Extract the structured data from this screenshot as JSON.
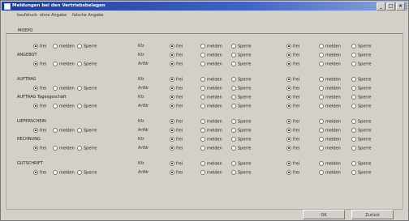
{
  "window": {
    "title": "Meldungen bei den Vertriebsbelegen",
    "controls": [
      "_",
      "□",
      "×"
    ]
  },
  "tabs": [
    "kaufdruck",
    "ohne Angabe",
    "falsche Angabe"
  ],
  "group_label": "MOEPO",
  "options": [
    "frei",
    "melden",
    "Sperre"
  ],
  "kfz_label": "Kfz",
  "artnr_label": "ArtNr",
  "sections": [
    {
      "name": "MOEPO",
      "subtitle": "ANGEBOT"
    },
    {
      "name": "AUFTRAG"
    },
    {
      "name": "AUFTRAG Tagesgeschäft"
    },
    {
      "name": "LIEFERSCHEIN"
    },
    {
      "name": "RECHNUNG"
    },
    {
      "name": "GUTSCHRIFT"
    }
  ],
  "rows": [
    {
      "label": "",
      "left_options": [
        "frei",
        "melden",
        "Sperre"
      ],
      "tag": "Kfz",
      "cols": [
        "frei",
        "melden",
        "Sperre",
        "frei",
        "melden",
        "Sperre"
      ],
      "checked": [
        true,
        false,
        false,
        true,
        false,
        false
      ]
    },
    {
      "label": "ANGEBOT",
      "left_options": [],
      "tag": "Kfz",
      "cols": [
        "frei",
        "melden",
        "Sperre",
        "frei",
        "melden",
        "Sperre"
      ],
      "checked": [
        true,
        false,
        false,
        true,
        false,
        false
      ]
    },
    {
      "label": "",
      "left_options": [
        "frei",
        "melden",
        "Sperre"
      ],
      "tag": "ArtNr",
      "cols": [
        "frei",
        "melden",
        "Sperre",
        "frei",
        "melden",
        "Sperre"
      ],
      "checked": [
        true,
        false,
        false,
        true,
        false,
        false
      ]
    },
    {
      "label": "AUFTRAG",
      "left_options": [],
      "tag": "Kfz",
      "cols": [
        "frei",
        "melden",
        "Sperre",
        "frei",
        "melden",
        "Sperre"
      ],
      "checked": [
        true,
        false,
        false,
        true,
        false,
        false
      ]
    },
    {
      "label": "",
      "left_options": [
        "frei",
        "melden",
        "Sperre"
      ],
      "tag": "ArtNr",
      "cols": [
        "frei",
        "melden",
        "Sperre",
        "frei",
        "melden",
        "Sperre"
      ],
      "checked": [
        true,
        false,
        false,
        true,
        false,
        false
      ]
    },
    {
      "label": "AUFTRAG Tagesgeschäft",
      "left_options": [],
      "tag": "Kfz",
      "cols": [
        "frei",
        "melden",
        "Sperre",
        "frei",
        "melden",
        "Sperre"
      ],
      "checked": [
        true,
        false,
        false,
        true,
        false,
        false
      ]
    },
    {
      "label": "",
      "left_options": [
        "frei",
        "melden",
        "Sperre"
      ],
      "tag": "ArtNr",
      "cols": [
        "frei",
        "melden",
        "Sperre",
        "frei",
        "melden",
        "Sperre"
      ],
      "checked": [
        true,
        false,
        false,
        true,
        false,
        false
      ]
    },
    {
      "label": "LIEFERSCHEIN",
      "left_options": [],
      "tag": "Kfz",
      "cols": [
        "frei",
        "melden",
        "Sperre",
        "frei",
        "melden",
        "Sperre"
      ],
      "checked": [
        true,
        false,
        false,
        true,
        false,
        false
      ]
    },
    {
      "label": "",
      "left_options": [
        "frei",
        "melden",
        "Sperre"
      ],
      "tag": "ArtNr",
      "cols": [
        "frei",
        "melden",
        "Sperre",
        "frei",
        "melden",
        "Sperre"
      ],
      "checked": [
        true,
        false,
        false,
        true,
        false,
        false
      ]
    },
    {
      "label": "RECHNUNG",
      "left_options": [],
      "tag": "Kfz",
      "cols": [
        "frei",
        "melden",
        "Sperre",
        "frei",
        "melden",
        "Sperre"
      ],
      "checked": [
        true,
        false,
        false,
        true,
        false,
        false
      ]
    },
    {
      "label": "",
      "left_options": [
        "frei",
        "melden",
        "Sperre"
      ],
      "tag": "ArtNr",
      "cols": [
        "frei",
        "melden",
        "Sperre",
        "frei",
        "melden",
        "Sperre"
      ],
      "checked": [
        true,
        false,
        false,
        true,
        false,
        false
      ]
    },
    {
      "label": "GUTSCHRIFT",
      "left_options": [],
      "tag": "Kfz",
      "cols": [
        "frei",
        "melden",
        "Sperre",
        "frei",
        "melden",
        "Sperre"
      ],
      "checked": [
        true,
        false,
        false,
        true,
        false,
        false
      ]
    },
    {
      "label": "",
      "left_options": [
        "frei",
        "melden",
        "Sperre"
      ],
      "tag": "ArtNr",
      "cols": [
        "frei",
        "melden",
        "Sperre",
        "frei",
        "melden",
        "Sperre"
      ],
      "checked": [
        true,
        false,
        false,
        true,
        false,
        false
      ]
    }
  ],
  "buttons": {
    "ok": "OK",
    "cancel": "Zurück"
  }
}
